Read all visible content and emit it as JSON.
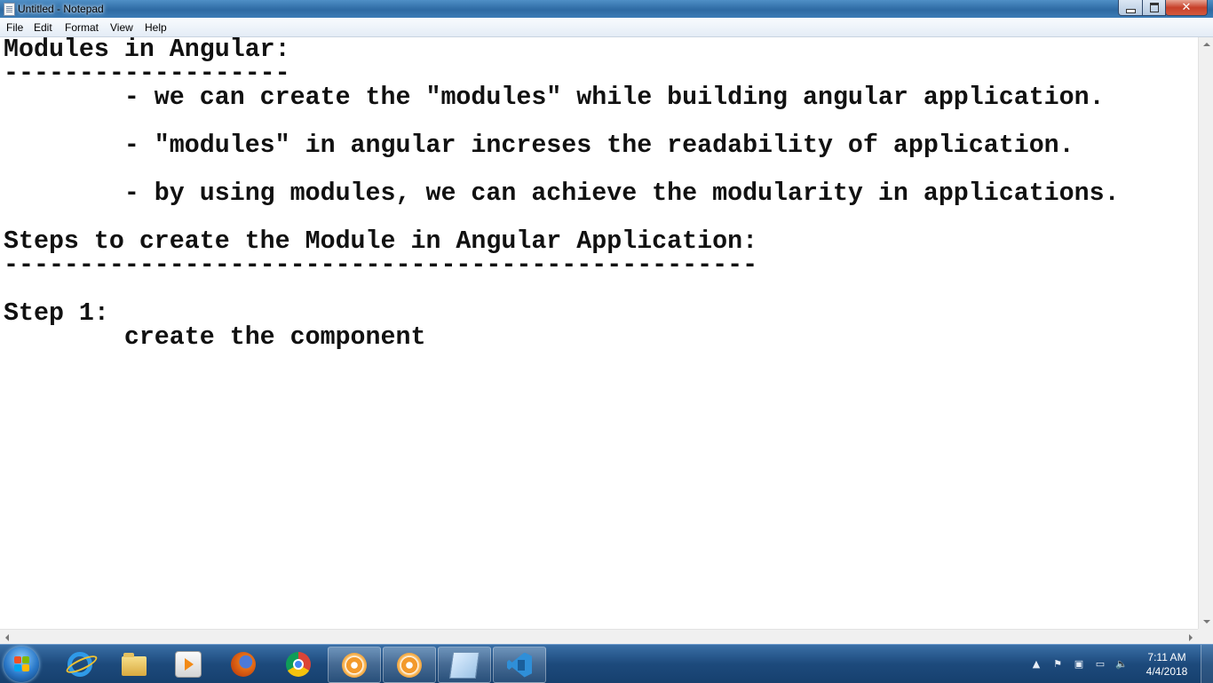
{
  "window": {
    "title": "Untitled - Notepad",
    "close_glyph": "✕"
  },
  "menu": {
    "file": "File",
    "edit": "Edit",
    "format": "Format",
    "view": "View",
    "help": "Help"
  },
  "document": {
    "lines": [
      "Modules in Angular:",
      "-------------------",
      "        - we can create the \"modules\" while building angular application.",
      "",
      "        - \"modules\" in angular increses the readability of application.",
      "",
      "        - by using modules, we can achieve the modularity in applications.",
      "",
      "Steps to create the Module in Angular Application:",
      "--------------------------------------------------",
      "",
      "Step 1:",
      "        create the component"
    ]
  },
  "taskbar": {
    "pinned": [
      {
        "name": "internet-explorer-icon"
      },
      {
        "name": "file-explorer-icon"
      },
      {
        "name": "media-player-icon"
      },
      {
        "name": "firefox-icon"
      },
      {
        "name": "chrome-icon"
      },
      {
        "name": "app-flower-icon"
      },
      {
        "name": "app-flower-icon"
      },
      {
        "name": "notepad-icon"
      },
      {
        "name": "vscode-icon"
      }
    ],
    "tray": {
      "show_hidden": "▲",
      "flag": "⚑",
      "network": "▭",
      "volume": "🔈"
    },
    "clock": {
      "time": "7:11 AM",
      "date": "4/4/2018"
    }
  },
  "colors": {
    "taskbar": "#1d4a7c",
    "title_bar": "#2d6aa3",
    "close_button": "#c7402a",
    "text": "#111111"
  }
}
